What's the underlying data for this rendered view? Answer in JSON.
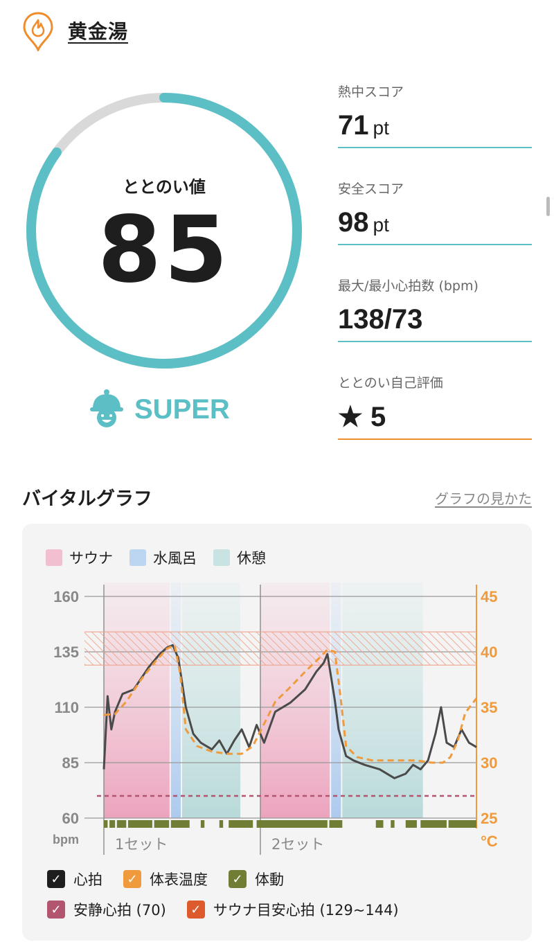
{
  "header": {
    "title": "黄金湯",
    "icon": "sauna-flame-pin-icon"
  },
  "gauge": {
    "label": "ととのい値",
    "value": "85",
    "progress_percent": 85,
    "track_color": "#d9d9d9",
    "fill_color": "#5bbfc5"
  },
  "rank": {
    "text": "SUPER",
    "icon": "bell-mascot-icon",
    "color": "#5bbfc5"
  },
  "stats": [
    {
      "label": "熱中スコア",
      "value": "71",
      "unit": "pt"
    },
    {
      "label": "安全スコア",
      "value": "98",
      "unit": "pt"
    },
    {
      "label": "最大/最小心拍数 (bpm)",
      "value": "138/73",
      "unit": ""
    },
    {
      "label": "ととのい自己評価",
      "value": "★ 5",
      "unit": ""
    }
  ],
  "vital_graph": {
    "title": "バイタルグラフ",
    "help_link": "グラフの見かた",
    "legend_top": [
      {
        "label": "サウナ",
        "color": "#f1bfd0"
      },
      {
        "label": "水風呂",
        "color": "#bcd6f2"
      },
      {
        "label": "休憩",
        "color": "#c9e3e3"
      }
    ],
    "legend_bottom": [
      {
        "label": "心拍",
        "color": "#1e1e1e"
      },
      {
        "label": "体表温度",
        "color": "#ef9a3d"
      },
      {
        "label": "体動",
        "color": "#6f7d35"
      },
      {
        "label": "安静心拍 (70)",
        "color": "#b2566f"
      },
      {
        "label": "サウナ目安心拍 (129~144)",
        "color": "#dd5a2c"
      }
    ]
  },
  "chart_data": {
    "type": "line",
    "left_axis": {
      "ticks": [
        "160",
        "135",
        "110",
        "85",
        "60"
      ],
      "values": [
        160,
        135,
        110,
        85,
        60
      ],
      "unit": "bpm",
      "ylim": [
        60,
        160
      ]
    },
    "right_axis": {
      "ticks": [
        "45",
        "40",
        "35",
        "30",
        "25"
      ],
      "values": [
        45,
        40,
        35,
        30,
        25
      ],
      "unit": "°C",
      "ylim": [
        25,
        45
      ]
    },
    "x_labels": [
      "1セット",
      "2セット"
    ],
    "phases": [
      {
        "type": "sauna",
        "start": 0.0,
        "end": 0.18
      },
      {
        "type": "cold",
        "start": 0.18,
        "end": 0.21
      },
      {
        "type": "rest",
        "start": 0.21,
        "end": 0.37
      },
      {
        "type": "gap",
        "start": 0.37,
        "end": 0.42
      },
      {
        "type": "sauna",
        "start": 0.42,
        "end": 0.61
      },
      {
        "type": "cold",
        "start": 0.61,
        "end": 0.64
      },
      {
        "type": "rest",
        "start": 0.64,
        "end": 0.86
      }
    ],
    "resting_hr": 70,
    "sauna_target_hr": [
      129,
      144
    ],
    "max_hr": 138,
    "min_hr": 73,
    "series": [
      {
        "name": "心拍",
        "axis": "left",
        "x": [
          0.0,
          0.01,
          0.02,
          0.03,
          0.05,
          0.08,
          0.12,
          0.15,
          0.17,
          0.185,
          0.2,
          0.22,
          0.24,
          0.26,
          0.29,
          0.31,
          0.33,
          0.35,
          0.37,
          0.39,
          0.41,
          0.43,
          0.46,
          0.5,
          0.54,
          0.57,
          0.59,
          0.6,
          0.62,
          0.63,
          0.65,
          0.67,
          0.7,
          0.74,
          0.78,
          0.81,
          0.83,
          0.85,
          0.87,
          0.89,
          0.905,
          0.92,
          0.94,
          0.96,
          0.98,
          1.0
        ],
        "y": [
          82,
          115,
          100,
          108,
          116,
          118,
          128,
          134,
          137,
          138,
          132,
          110,
          98,
          94,
          91,
          95,
          89,
          95,
          100,
          92,
          102,
          94,
          108,
          112,
          118,
          126,
          130,
          134,
          113,
          100,
          88,
          86,
          84,
          82,
          78,
          80,
          84,
          82,
          86,
          98,
          110,
          94,
          92,
          100,
          94,
          92
        ]
      },
      {
        "name": "体表温度",
        "axis": "right",
        "x": [
          0.0,
          0.03,
          0.06,
          0.1,
          0.14,
          0.17,
          0.19,
          0.205,
          0.22,
          0.25,
          0.29,
          0.33,
          0.37,
          0.4,
          0.43,
          0.46,
          0.5,
          0.54,
          0.58,
          0.6,
          0.62,
          0.635,
          0.65,
          0.68,
          0.72,
          0.76,
          0.8,
          0.84,
          0.88,
          0.91,
          0.93,
          0.95,
          0.97,
          1.0
        ],
        "y": [
          34.3,
          34.4,
          35.5,
          37.5,
          39.2,
          40.3,
          40.6,
          38.0,
          33.0,
          31.5,
          31.0,
          30.8,
          30.8,
          31.5,
          33.5,
          35.5,
          36.8,
          38.2,
          39.5,
          40.2,
          40.0,
          36.0,
          31.5,
          30.5,
          30.2,
          30.2,
          30.2,
          30.2,
          30.0,
          30.0,
          30.5,
          32.0,
          34.5,
          35.8
        ]
      },
      {
        "name": "体動",
        "type": "activity-bar"
      }
    ]
  }
}
